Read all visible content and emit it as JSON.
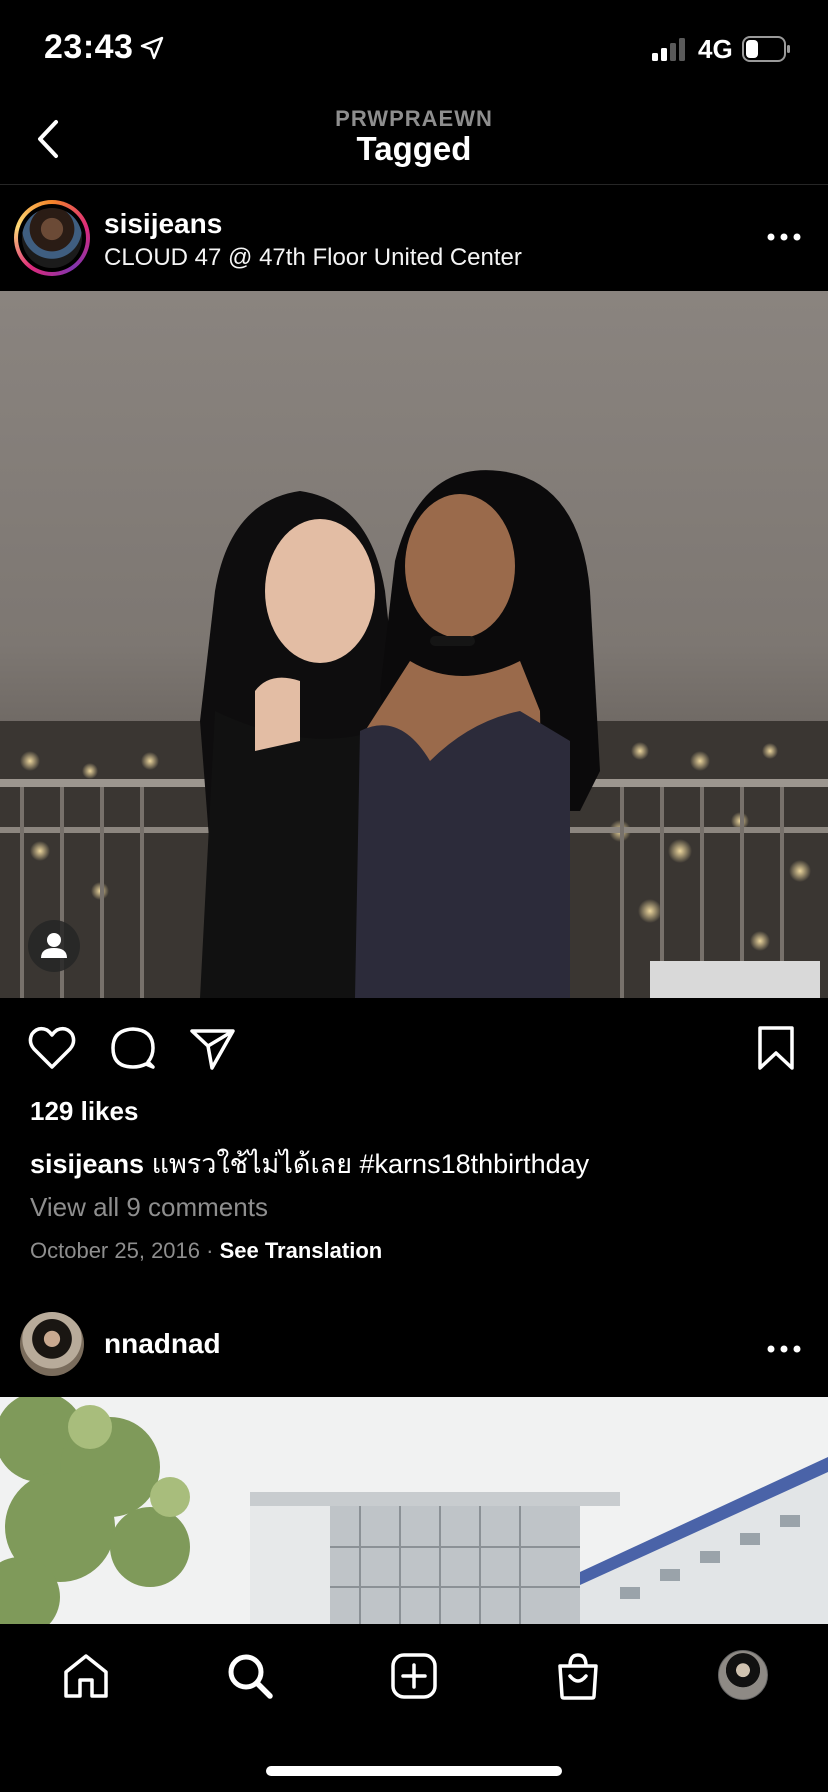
{
  "status_bar": {
    "time": "23:43",
    "network": "4G"
  },
  "header": {
    "subtitle": "PRWPRAEWN",
    "title": "Tagged"
  },
  "post1": {
    "username": "sisijeans",
    "location": "CLOUD 47 @ 47th Floor United Center",
    "likes": "129 likes",
    "caption_user": "sisijeans",
    "caption_text": " แพรวใช้ไม่ได้เลย #karns18thbirthday",
    "view_comments": "View all 9 comments",
    "date": "October 25, 2016",
    "separator": " · ",
    "see_translation": "See Translation"
  },
  "post2": {
    "username": "nnadnad"
  },
  "icons": {
    "back": "chevron-left-icon",
    "more": "more-horizontal-icon",
    "like": "heart-icon",
    "comment": "comment-icon",
    "share": "send-icon",
    "save": "bookmark-icon",
    "tags": "person-icon",
    "nav": [
      "home-icon",
      "search-icon",
      "plus-square-icon",
      "shopping-bag-icon",
      "profile-avatar"
    ]
  },
  "colors": {
    "background": "#000000",
    "text": "#ffffff",
    "muted": "#8e8e8e",
    "divider": "#262626"
  }
}
